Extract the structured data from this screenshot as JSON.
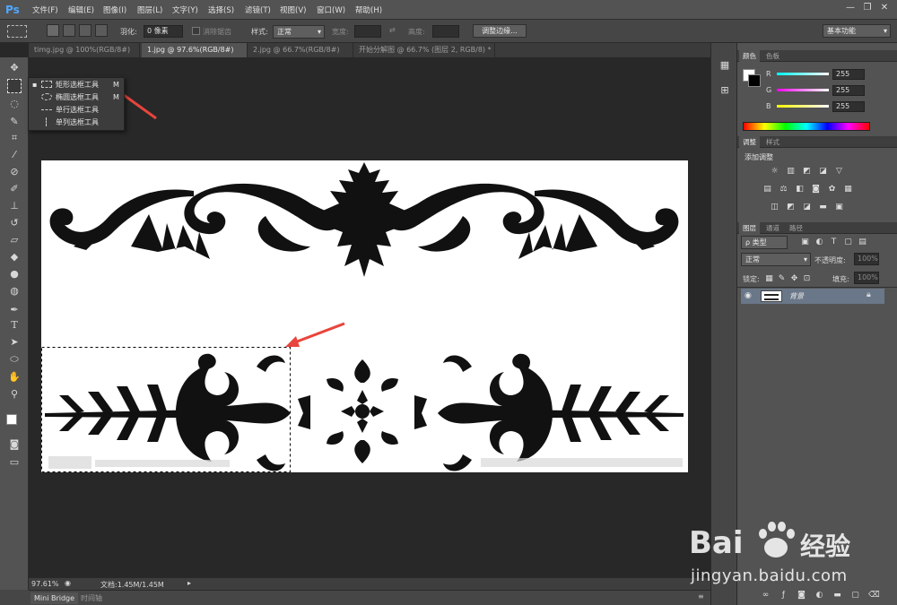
{
  "app": {
    "logo": "Ps"
  },
  "menu": [
    "文件(F)",
    "编辑(E)",
    "图像(I)",
    "图层(L)",
    "文字(Y)",
    "选择(S)",
    "滤镜(T)",
    "视图(V)",
    "窗口(W)",
    "帮助(H)"
  ],
  "window_controls": {
    "minimize": "—",
    "restore": "❐",
    "close": "✕"
  },
  "options": {
    "feather_label": "羽化:",
    "feather_value": "0 像素",
    "antialias_label": "消除锯齿",
    "style_label": "样式:",
    "style_value": "正常",
    "width_label": "宽度:",
    "height_label": "高度:",
    "refine_edge_button": "调整边缘...",
    "workspace_value": "基本功能"
  },
  "tabs": [
    {
      "label": "timg.jpg @ 100%(RGB/8#)",
      "active": false
    },
    {
      "label": "1.jpg @ 97.6%(RGB/8#)",
      "active": true
    },
    {
      "label": "2.jpg @ 66.7%(RGB/8#)",
      "active": false
    },
    {
      "label": "开始分解图 @ 66.7% (图层 2, RGB/8) *",
      "active": false
    }
  ],
  "flyout": [
    {
      "label": "矩形选框工具",
      "key": "M",
      "selected": true,
      "icon": "rect-marquee-icon"
    },
    {
      "label": "椭圆选框工具",
      "key": "M",
      "selected": false,
      "icon": "ellipse-marquee-icon"
    },
    {
      "label": "单行选框工具",
      "key": "",
      "selected": false,
      "icon": "single-row-marquee-icon"
    },
    {
      "label": "单列选框工具",
      "key": "",
      "selected": false,
      "icon": "single-column-marquee-icon"
    }
  ],
  "status": {
    "zoom": "97.61%",
    "doc": "文档:1.45M/1.45M"
  },
  "bottom_tabs": [
    "Mini Bridge",
    "时间轴"
  ],
  "color_panel": {
    "tabs": [
      "颜色",
      "色板"
    ],
    "r_label": "R",
    "g_label": "G",
    "b_label": "B",
    "r": "255",
    "g": "255",
    "b": "255"
  },
  "adjust_panel": {
    "tabs": [
      "调整",
      "样式"
    ],
    "title": "添加调整"
  },
  "layers_panel": {
    "tabs": [
      "图层",
      "通道",
      "路径"
    ],
    "kind_label": "ρ 类型",
    "blend_value": "正常",
    "opacity_label": "不透明度:",
    "opacity_value": "100%",
    "lock_label": "锁定:",
    "fill_label": "填充:",
    "fill_value": "100%",
    "layer_name": "背景"
  },
  "watermark": {
    "brand": "Bai",
    "brand2": "经验",
    "url": "jingyan.baidu.com"
  },
  "colors": {
    "accent_red": "#e8453c",
    "ps_blue": "#4fa8ff",
    "layer_selected": "#6a7788"
  }
}
